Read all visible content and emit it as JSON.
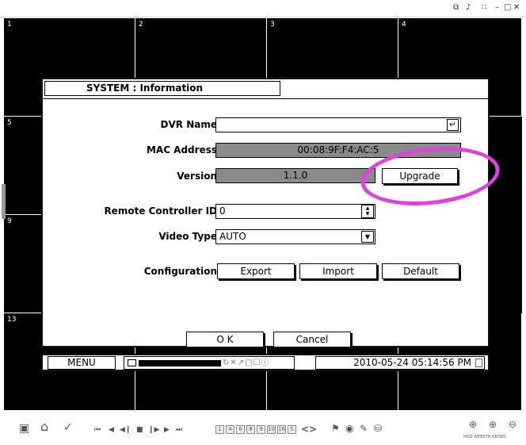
{
  "window": {
    "controls": [
      "⧉",
      "♪",
      "∷",
      "–",
      "□",
      "✕"
    ]
  },
  "grid": {
    "channels": [
      "1",
      "2",
      "3",
      "4",
      "5",
      "9",
      "13"
    ]
  },
  "dialog": {
    "title": "SYSTEM : Information",
    "fields": {
      "dvr_name": {
        "label": "DVR Name",
        "value": ""
      },
      "mac_address": {
        "label": "MAC Address",
        "value": "00:08:9F:F4:AC:5"
      },
      "version": {
        "label": "Version",
        "value": "1.1.0"
      },
      "remote_id": {
        "label": "Remote Controller ID",
        "value": "0"
      },
      "video_type": {
        "label": "Video Type",
        "value": "AUTO"
      },
      "configuration": {
        "label": "Configuration"
      }
    },
    "buttons": {
      "upgrade": "Upgrade",
      "export": "Export",
      "import": "Import",
      "default": "Default",
      "ok": "O K",
      "cancel": "Cancel"
    },
    "colon": ":",
    "enter_glyph": "↵",
    "dropdown_glyph": "▼",
    "spin_up": "▲",
    "spin_down": "▼"
  },
  "status": {
    "menu": "MENU",
    "rec_icons": "↻✕↗□☐ⓘ",
    "datetime": "2010-05-24 05:14:56 PM"
  },
  "toolbar": {
    "icons": {
      "camera": "▣",
      "home": "⌂",
      "search": "✓",
      "first": "⏮",
      "rewind": "◀",
      "step_back": "◀❙",
      "stop": "■",
      "step_fwd": "❙▶",
      "play": "▶",
      "last": "⏭",
      "prev": "<",
      "next": ">",
      "alarm": "⚑",
      "record": "◉",
      "pen": "✎",
      "disk": "⛁",
      "zoom_in": "⊕",
      "zoom_alt": "⊕",
      "zoom_out": "⊖"
    },
    "channel_boxes": [
      "1",
      "4",
      "6",
      "8",
      "9",
      "10",
      "16",
      "S"
    ],
    "footnote": "HDD WEBSTH KB/SEC"
  },
  "colors": {
    "highlight": "#e040e0",
    "field_gray": "#8a8a8a",
    "grid_bg": "#000000"
  }
}
